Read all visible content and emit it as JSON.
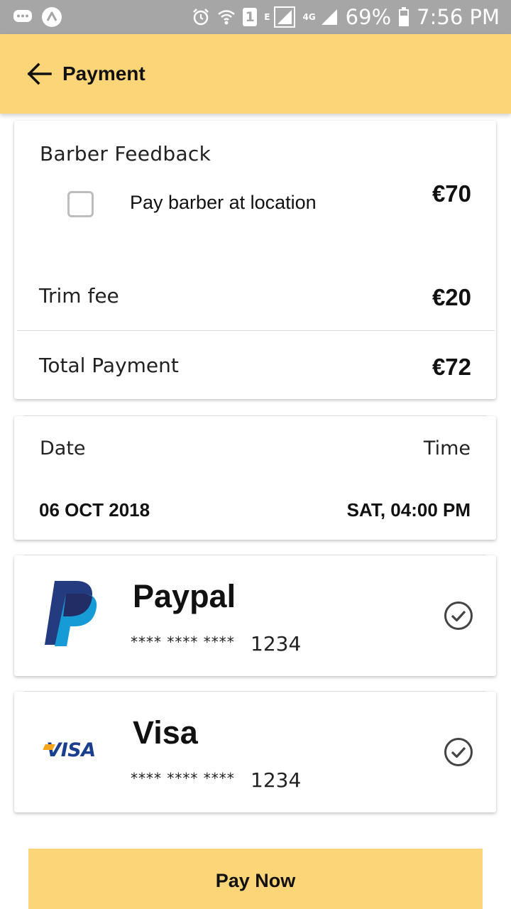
{
  "status_bar": {
    "network_small": "E",
    "network_type": "4G",
    "sim_number": "1",
    "battery": "69%",
    "time": "7:56 PM"
  },
  "header": {
    "title": "Payment"
  },
  "summary": {
    "title": "Barber Feedback",
    "pay_at_location_label": "Pay barber at location",
    "pay_at_location_checked": false,
    "service_price": "€70",
    "trim_fee_label": "Trim fee",
    "trim_fee_price": "€20",
    "total_label": "Total Payment",
    "total_price": "€72"
  },
  "schedule": {
    "date_label": "Date",
    "time_label": "Time",
    "date_value": "06 OCT 2018",
    "time_value": "SAT, 04:00 PM"
  },
  "payment_methods": [
    {
      "name": "Paypal",
      "masked": "**** **** ****",
      "last4": "1234",
      "icon": "paypal-logo"
    },
    {
      "name": "Visa",
      "masked": "**** **** ****",
      "last4": "1234",
      "icon": "visa-logo",
      "logo_text": "VISA"
    }
  ],
  "footer": {
    "pay_button_label": "Pay Now"
  },
  "colors": {
    "accent": "#fbd578",
    "status_bar": "#a6a6a6"
  }
}
